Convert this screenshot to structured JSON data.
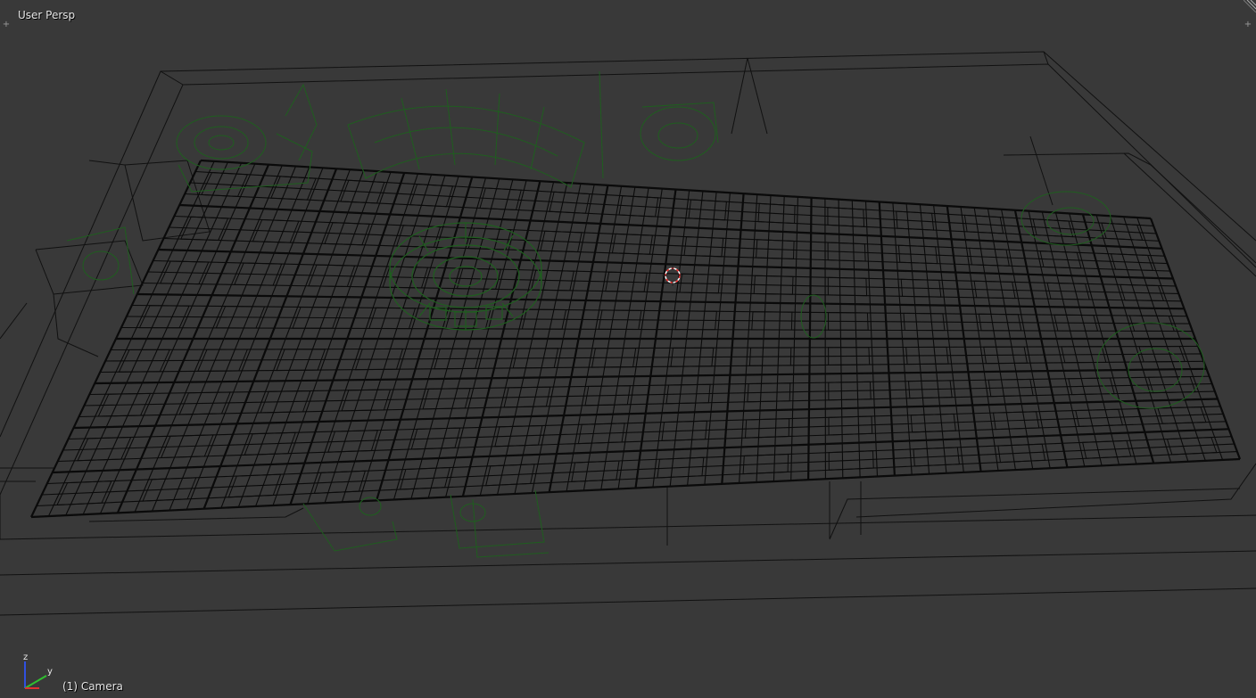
{
  "viewport": {
    "view_name": "User Persp",
    "object_info": "(1) Camera",
    "background_color": "#393939",
    "wire_color": "#000000",
    "selected_wire_color": "#1e5a1e",
    "cursor_color": "#ff3030"
  },
  "axis_gizmo": {
    "z_label": "z",
    "y_label": "y",
    "x_color": "#e03030",
    "y_color": "#30c030",
    "z_color": "#3050e0"
  },
  "icons": {
    "split_left": "plus-icon",
    "split_right": "plus-icon",
    "corner": "corner-drag-icon",
    "cursor": "3d-cursor-icon"
  }
}
